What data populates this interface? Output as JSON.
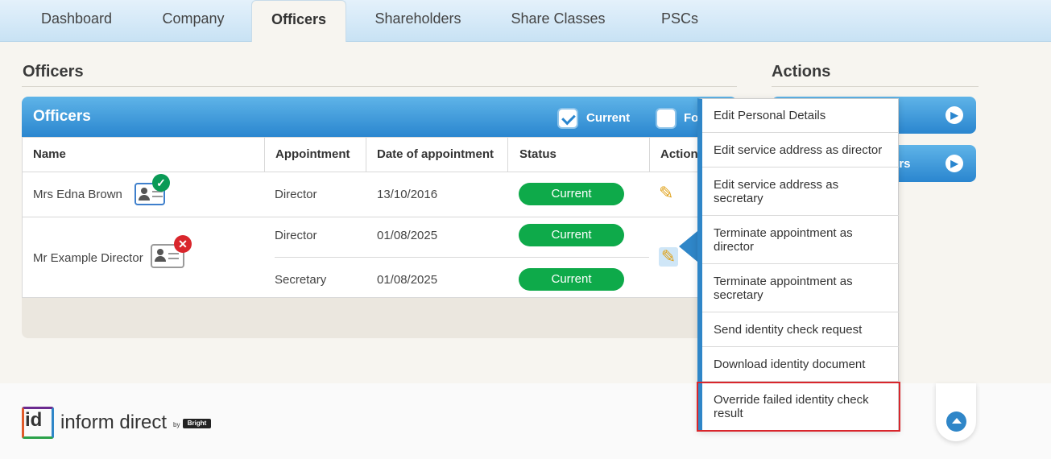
{
  "tabs": [
    {
      "label": "Dashboard"
    },
    {
      "label": "Company"
    },
    {
      "label": "Officers",
      "active": true
    },
    {
      "label": "Shareholders"
    },
    {
      "label": "Share Classes"
    },
    {
      "label": "PSCs"
    }
  ],
  "officers_section": {
    "title": "Officers"
  },
  "actions_section": {
    "title": "Actions",
    "buttons": [
      {
        "label": ""
      },
      {
        "label": "ters"
      }
    ]
  },
  "panel": {
    "title": "Officers",
    "filters": [
      {
        "label": "Current",
        "checked": true
      },
      {
        "label": "Fo",
        "checked": false
      }
    ]
  },
  "table": {
    "columns": [
      "Name",
      "Appointment",
      "Date of appointment",
      "Status",
      "Action"
    ],
    "rows": [
      {
        "name": "Mrs Edna Brown",
        "id_status": "verified",
        "appointments": [
          {
            "role": "Director",
            "date": "13/10/2016",
            "status": "Current"
          }
        ]
      },
      {
        "name": "Mr Example Director",
        "id_status": "failed",
        "appointments": [
          {
            "role": "Director",
            "date": "01/08/2025",
            "status": "Current"
          },
          {
            "role": "Secretary",
            "date": "01/08/2025",
            "status": "Current"
          }
        ]
      }
    ]
  },
  "menu": {
    "items": [
      "Edit Personal Details",
      "Edit service address as director",
      "Edit service address as secretary",
      "Terminate appointment as director",
      "Terminate appointment as secretary",
      "Send identity check request",
      "Download identity document",
      "Override failed identity check result"
    ],
    "highlighted_index": 7
  },
  "footer": {
    "logo_id": "id",
    "logo_text": "inform direct",
    "logo_by": "by",
    "logo_brand": "Bright"
  },
  "colors": {
    "accent": "#2f86c8",
    "status_green": "#0eaa4a",
    "verified": "#0a9a56",
    "failed": "#d9262c",
    "highlight": "#d9262c"
  },
  "icons": {
    "verified": "check-icon",
    "failed": "x-icon",
    "edit": "pencil-icon",
    "scroll_top": "arrow-up-icon"
  }
}
